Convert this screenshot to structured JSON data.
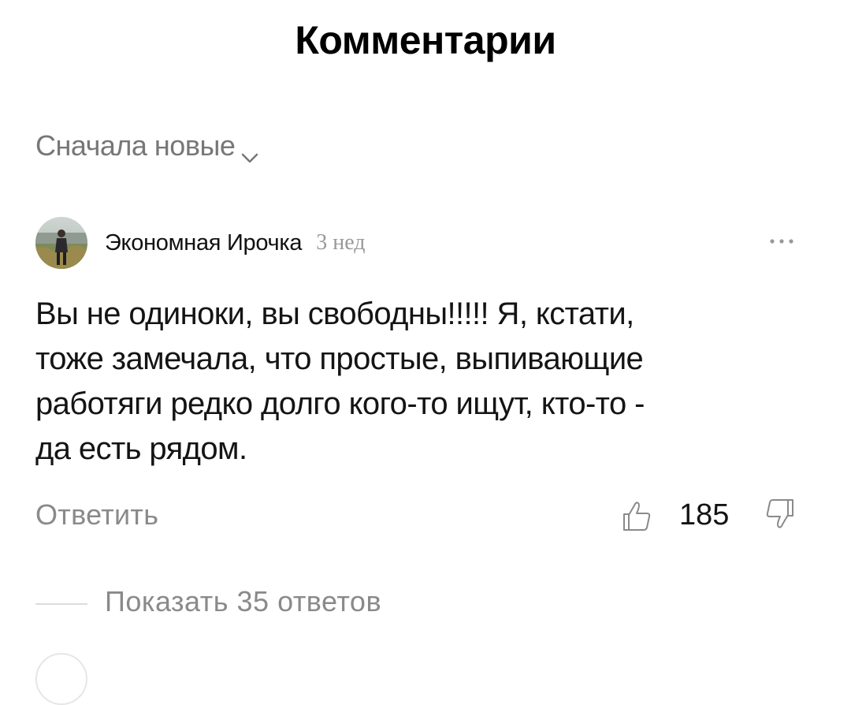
{
  "header": {
    "title": "Комментарии"
  },
  "sort": {
    "label": "Сначала новые",
    "icon": "chevron-down-icon"
  },
  "comment": {
    "author": "Экономная Ирочка",
    "time": "3 нед",
    "text": "Вы не одиноки, вы свободны!!!!! Я, кстати,\nтоже замечала, что простые, выпивающие\nработяги редко долго кого-то ищут, кто-то -\nда есть рядом.",
    "reply_label": "Ответить",
    "likes": "185",
    "like_icon": "thumbs-up-icon",
    "dislike_icon": "thumbs-down-icon",
    "more_icon": "more-dots-icon"
  },
  "replies": {
    "label": "Показать 35 ответов"
  },
  "colors": {
    "text": "#141414",
    "muted": "#8a8a8a",
    "time": "#999999"
  }
}
